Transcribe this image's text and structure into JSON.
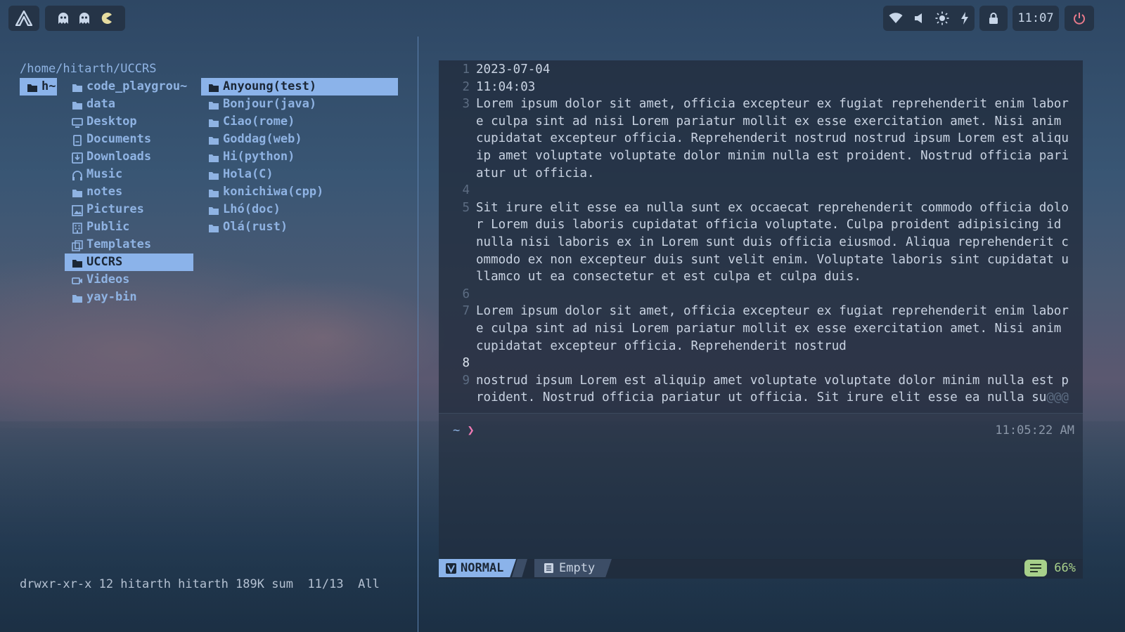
{
  "topbar": {
    "clock": "11:07"
  },
  "filemanager": {
    "path": "/home/hitarth/UCCRS",
    "parent": [
      {
        "label": "h~",
        "selected": true
      }
    ],
    "current": [
      {
        "label": "code_playgrou~",
        "icon": "folder-icon"
      },
      {
        "label": "data",
        "icon": "folder-icon"
      },
      {
        "label": "Desktop",
        "icon": "desktop-icon"
      },
      {
        "label": "Documents",
        "icon": "documents-icon"
      },
      {
        "label": "Downloads",
        "icon": "download-icon"
      },
      {
        "label": "Music",
        "icon": "headphones-icon"
      },
      {
        "label": "notes",
        "icon": "folder-icon"
      },
      {
        "label": "Pictures",
        "icon": "picture-icon"
      },
      {
        "label": "Public",
        "icon": "building-icon"
      },
      {
        "label": "Templates",
        "icon": "template-icon"
      },
      {
        "label": "UCCRS",
        "icon": "folder-icon",
        "selected": true
      },
      {
        "label": "Videos",
        "icon": "video-icon"
      },
      {
        "label": "yay-bin",
        "icon": "folder-icon"
      }
    ],
    "preview": [
      {
        "label": "Anyoung(test)",
        "selected": true
      },
      {
        "label": "Bonjour(java)"
      },
      {
        "label": "Ciao(rome)"
      },
      {
        "label": "Goddag(web)"
      },
      {
        "label": "Hi(python)"
      },
      {
        "label": "Hola(C)"
      },
      {
        "label": "konichiwa(cpp)"
      },
      {
        "label": "Lhó(doc)"
      },
      {
        "label": "Olá(rust)"
      }
    ],
    "status": {
      "perms": "drwxr-xr-x 12 hitarth hitarth 189K sum",
      "position": "11/13",
      "scroll": "All"
    }
  },
  "editor": {
    "lines": [
      {
        "num": "1",
        "text": "2023-07-04"
      },
      {
        "num": "2",
        "text": "11:04:03"
      },
      {
        "num": "3",
        "text": "Lorem ipsum dolor sit amet, officia excepteur ex fugiat reprehenderit enim labor"
      },
      {
        "num": "",
        "text": "e culpa sint ad nisi Lorem pariatur mollit ex esse exercitation amet. Nisi anim"
      },
      {
        "num": "",
        "text": "cupidatat excepteur officia. Reprehenderit nostrud nostrud ipsum Lorem est aliqu"
      },
      {
        "num": "",
        "text": "ip amet voluptate voluptate dolor minim nulla est proident. Nostrud officia pari"
      },
      {
        "num": "",
        "text": "atur ut officia."
      },
      {
        "num": "4",
        "text": ""
      },
      {
        "num": "5",
        "text": "Sit irure elit esse ea nulla sunt ex occaecat reprehenderit commodo officia dolo"
      },
      {
        "num": "",
        "text": "r Lorem duis laboris cupidatat officia voluptate. Culpa proident adipisicing id"
      },
      {
        "num": "",
        "text": "nulla nisi laboris ex in Lorem sunt duis officia eiusmod. Aliqua reprehenderit c"
      },
      {
        "num": "",
        "text": "ommodo ex non excepteur duis sunt velit enim. Voluptate laboris sint cupidatat u"
      },
      {
        "num": "",
        "text": "llamco ut ea consectetur et est culpa et culpa duis."
      },
      {
        "num": "6",
        "text": ""
      },
      {
        "num": "7",
        "text": "Lorem ipsum dolor sit amet, officia excepteur ex fugiat reprehenderit enim labor"
      },
      {
        "num": "",
        "text": "e culpa sint ad nisi Lorem pariatur mollit ex esse exercitation amet. Nisi anim"
      },
      {
        "num": "",
        "text": "cupidatat excepteur officia. Reprehenderit nostrud"
      },
      {
        "num": "8",
        "text": "",
        "current": true
      },
      {
        "num": "9",
        "text": "nostrud ipsum Lorem est aliquip amet voluptate voluptate dolor minim nulla est p"
      },
      {
        "num": "",
        "text": "roident. Nostrud officia pariatur ut officia. Sit irure elit esse ea nulla su@@@"
      }
    ]
  },
  "terminal": {
    "prompt_dir": "~",
    "prompt_symbol": "❯",
    "time": "11:05:22 AM"
  },
  "statusline": {
    "mode": "NORMAL",
    "file": "Empty",
    "percent": "66%"
  }
}
